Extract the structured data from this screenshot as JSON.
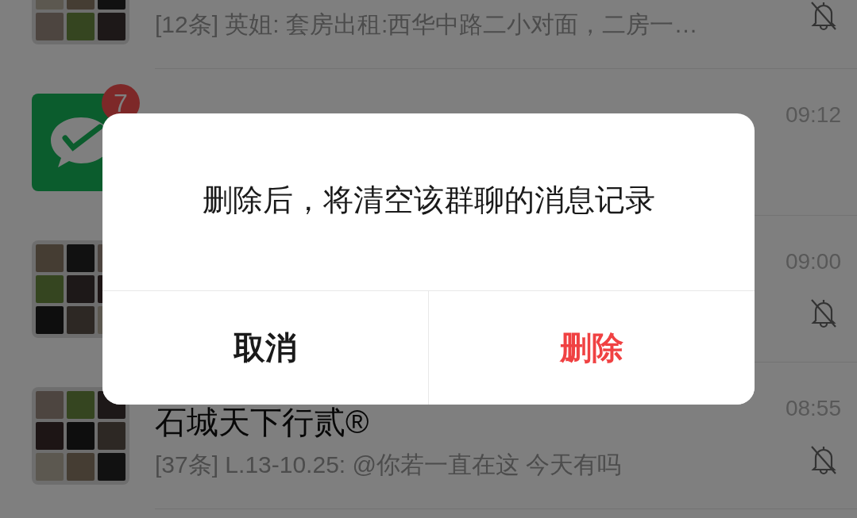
{
  "chats": [
    {
      "kind": "group",
      "preview": "[12条] 英姐: 套房出租:西华中路二小对面，二房一…",
      "muted": true
    },
    {
      "kind": "payment",
      "badge": "7",
      "time": "09:12",
      "muted": false
    },
    {
      "kind": "group",
      "time": "09:00",
      "muted": true
    },
    {
      "kind": "group",
      "title": "石城天下行贰®",
      "preview": "[37条] L.13-10.25: @你若一直在这 今天有吗",
      "time": "08:55",
      "muted": true
    }
  ],
  "dialog": {
    "message": "删除后，将清空该群聊的消息记录",
    "buttons": [
      {
        "label": "取消",
        "kind": "cancel"
      },
      {
        "label": "删除",
        "kind": "destructive"
      }
    ]
  }
}
